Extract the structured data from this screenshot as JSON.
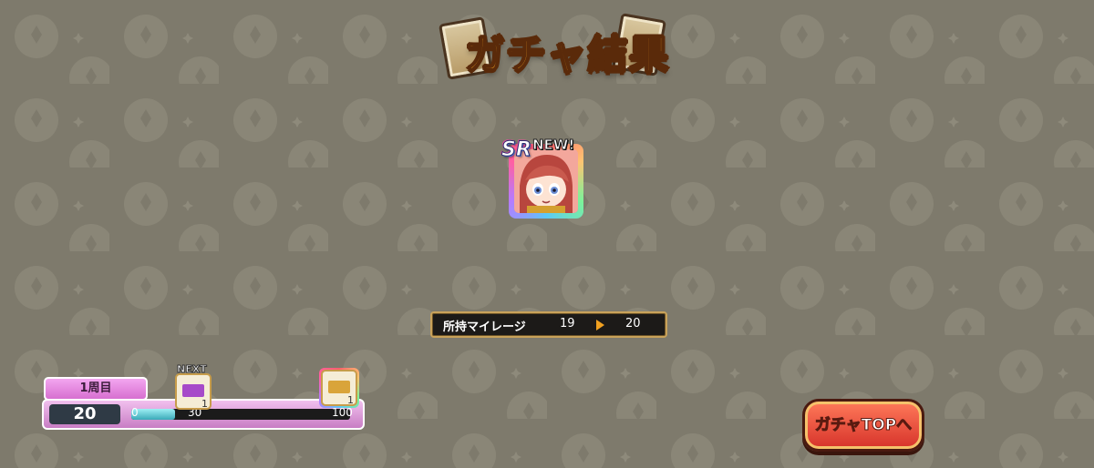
{
  "header": {
    "title": "ガチャ結果"
  },
  "result": {
    "rarity": "SR",
    "new_badge": "NEW!",
    "character_icon": "character-portrait"
  },
  "mileage": {
    "label": "所持マイレージ",
    "from": "19",
    "to": "20"
  },
  "progress": {
    "lap_label": "1周目",
    "count": "20",
    "current": 20,
    "max": 100,
    "ticks": [
      "0",
      "30",
      "100"
    ],
    "next_label": "NEXT",
    "next_reward_count": "1",
    "final_reward_count": "1",
    "next_reward_color": "#a64ac9",
    "final_reward_color": "#d9a43a"
  },
  "buttons": {
    "gacha_top": "ガチャTOPへ"
  },
  "colors": {
    "background": "#7e7a6c",
    "title": "#f6a623",
    "button": "#e0432f",
    "progress_fill": "#5cc6d2",
    "lap_badge": "#e48be0"
  }
}
